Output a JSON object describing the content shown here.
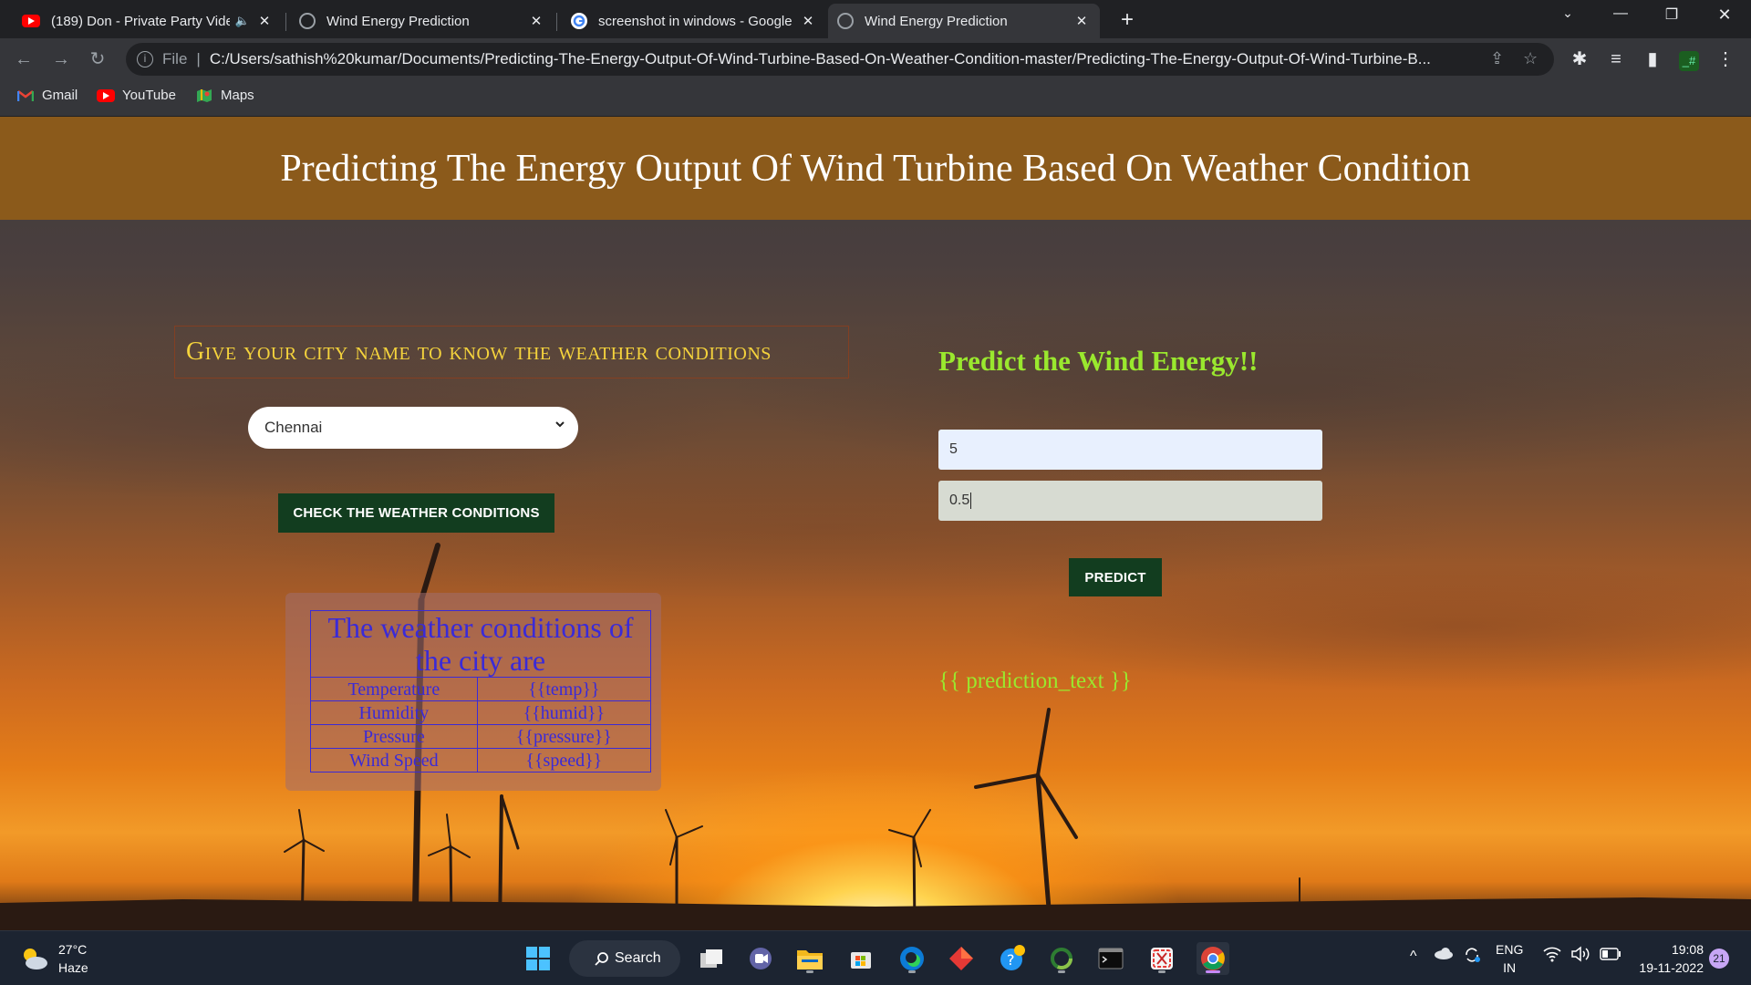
{
  "browser": {
    "tabs": [
      {
        "title": "(189) Don - Private Party Vide",
        "favicon": "youtube-icon",
        "audio": true
      },
      {
        "title": "Wind Energy Prediction",
        "favicon": "globe-icon"
      },
      {
        "title": "screenshot in windows - Google",
        "favicon": "google-icon"
      },
      {
        "title": "Wind Energy Prediction",
        "favicon": "globe-icon",
        "active": true
      }
    ],
    "address": {
      "scheme_label": "File",
      "url": "C:/Users/sathish%20kumar/Documents/Predicting-The-Energy-Output-Of-Wind-Turbine-Based-On-Weather-Condition-master/Predicting-The-Energy-Output-Of-Wind-Turbine-B..."
    },
    "bookmarks": [
      {
        "label": "Gmail",
        "icon": "gmail-icon"
      },
      {
        "label": "YouTube",
        "icon": "youtube-icon"
      },
      {
        "label": "Maps",
        "icon": "maps-icon"
      }
    ]
  },
  "page": {
    "header_title": "Predicting The Energy Output Of Wind Turbine Based On Weather Condition",
    "city_prompt": "Give your city name to know the weather conditions",
    "city_select_value": "Chennai",
    "check_button": "CHECK THE WEATHER CONDITIONS",
    "weather_table": {
      "title": "The weather conditions of the city are",
      "rows": [
        {
          "label": "Temperature",
          "value": "{{temp}}"
        },
        {
          "label": "Humidity",
          "value": "{{humid}}"
        },
        {
          "label": "Pressure",
          "value": "{{pressure}}"
        },
        {
          "label": "Wind Speed",
          "value": "{{speed}}"
        }
      ]
    },
    "predict_title": "Predict the Wind Energy!!",
    "input1_value": "5",
    "input2_value": "0.5",
    "predict_button": "PREDICT",
    "prediction_text": "{{ prediction_text }}",
    "colors": {
      "header_bg": "#8b5a1b",
      "city_prompt": "#f5d33c",
      "predict_title": "#9ae82e",
      "table_text": "#3a2ad8",
      "button_bg": "#123d1f"
    }
  },
  "taskbar": {
    "weather_temp": "27°C",
    "weather_desc": "Haze",
    "search_label": "Search",
    "lang_top": "ENG",
    "lang_bottom": "IN",
    "time": "19:08",
    "date": "19-11-2022",
    "notification_count": "21"
  }
}
